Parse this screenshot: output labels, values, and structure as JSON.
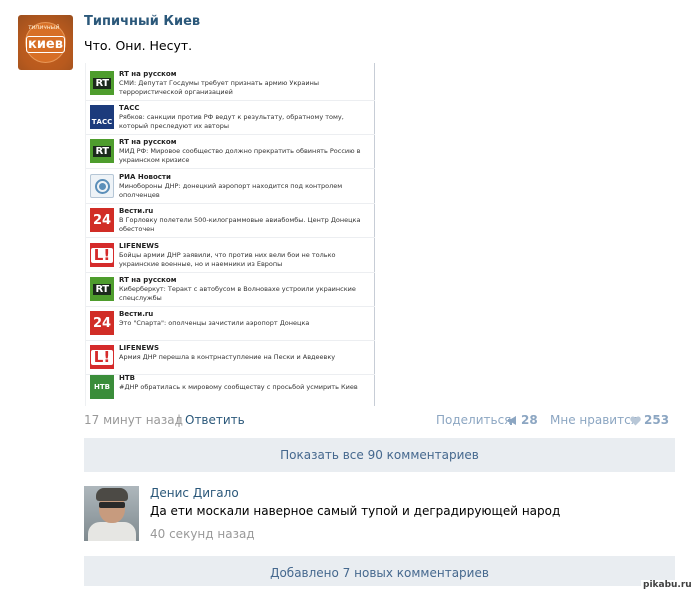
{
  "post": {
    "author": "Типичный Киев",
    "avatar_label": "киев",
    "avatar_tagline": "типичный",
    "text": "Что. Они. Несут.",
    "time": "17 минут назад",
    "separator": "|",
    "reply_label": "Ответить",
    "share_label": "Поделиться",
    "share_count": "28",
    "like_label": "Мне нравится",
    "like_count": "253"
  },
  "news": [
    {
      "source": "RT на русском",
      "logo": "rt",
      "headline": "СМИ: Депутат Госдумы требует признать армию Украины террористической организацией"
    },
    {
      "source": "ТАСС",
      "logo": "tass",
      "headline": "Рябков: санкции против РФ ведут к результату, обратному тому, который преследуют их авторы"
    },
    {
      "source": "RT на русском",
      "logo": "rt",
      "headline": "МИД РФ: Мировое сообщество должно прекратить обвинять Россию в украинском кризисе"
    },
    {
      "source": "РИА Новости",
      "logo": "ria",
      "headline": "Минобороны ДНР: донецкий аэропорт находится под контролем ополченцев"
    },
    {
      "source": "Вести.ru",
      "logo": "vesti",
      "headline": "В Горловку полетели 500-килограммовые авиабомбы. Центр Донецка обесточен"
    },
    {
      "source": "LIFENEWS",
      "logo": "life",
      "headline": "Бойцы армии ДНР заявили, что против них вели бои не только украинские военные, но и наемники из Европы"
    },
    {
      "source": "RT на русском",
      "logo": "rt",
      "headline": "Киберберкут: Теракт с автобусом в Волновахе устроили украинские спецслужбы"
    },
    {
      "source": "Вести.ru",
      "logo": "vesti",
      "headline": "Это \"Спарта\": ополченцы зачистили аэропорт Донецка"
    },
    {
      "source": "LIFENEWS",
      "logo": "life",
      "headline": "Армия ДНР перешла в контрнаступление на Пески и Авдеевку"
    },
    {
      "source": "НТВ",
      "logo": "ntv",
      "headline": "#ДНР обратилась к мировому сообществу с просьбой усмирить Киев"
    }
  ],
  "logos": {
    "rt_text": "RT",
    "tass_text": "ТАСС",
    "vesti_text": "24",
    "life_text": "L!",
    "ntv_text": "НТВ"
  },
  "show_all_label": "Показать все 90 комментариев",
  "comment": {
    "author": "Денис Дигало",
    "text": "Да ети москали наверное самый тупой и деградирующей народ",
    "time": "40 секунд назад"
  },
  "new_comments_label": "Добавлено 7 новых комментариев",
  "watermark": "pikabu.ru",
  "colors": {
    "link": "#2b587a",
    "muted": "#999999",
    "action": "#8ca6c2",
    "button_bg": "#e9edf1"
  }
}
